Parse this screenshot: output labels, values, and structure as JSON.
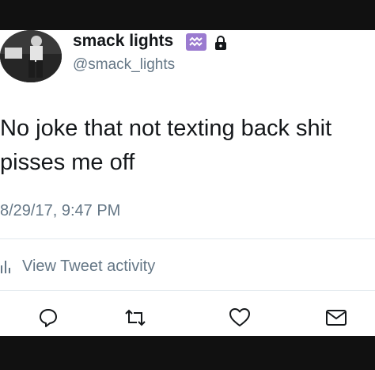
{
  "user": {
    "display_name": "smack lights",
    "handle": "@smack_lights",
    "badge_icon": "aquarius-emoji",
    "protected_icon": "lock-icon"
  },
  "tweet": {
    "text": "No joke that not texting back shit pisses me off",
    "timestamp": "8/29/17, 9:47 PM"
  },
  "activity": {
    "label": "View Tweet activity",
    "icon": "bar-chart-icon"
  },
  "actions": [
    {
      "name": "reply",
      "icon": "reply-icon"
    },
    {
      "name": "retweet",
      "icon": "retweet-icon"
    },
    {
      "name": "like",
      "icon": "heart-icon"
    },
    {
      "name": "message",
      "icon": "envelope-icon"
    }
  ],
  "colors": {
    "text": "#14171a",
    "secondary": "#657786",
    "badge": "#9b7bd0",
    "frame": "#111111"
  }
}
